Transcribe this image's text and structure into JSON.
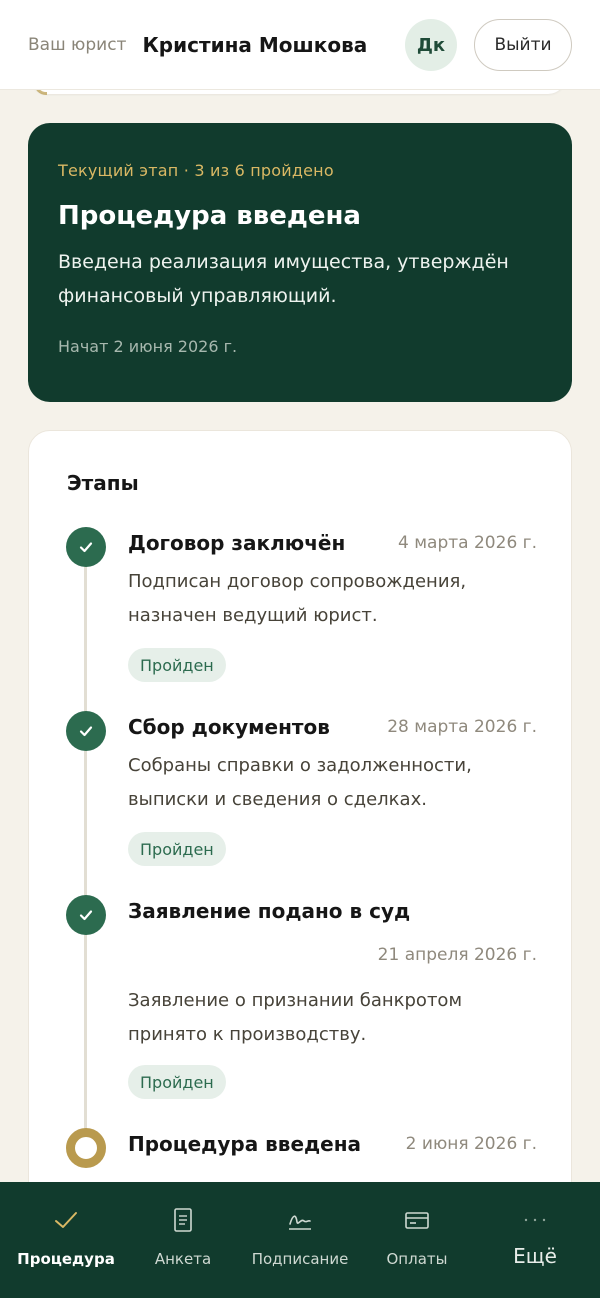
{
  "header": {
    "lawyer_caption": "Ваш юрист",
    "lawyer_name": "Кристина Мошкова",
    "avatar_initials": "Дк",
    "logout_label": "Выйти"
  },
  "current_stage": {
    "kicker": "Текущий этап · 3 из 6 пройдено",
    "title": "Процедура введена",
    "description": "Введена реализация имущества, утверждён финансовый управляющий.",
    "started": "Начат 2 июня 2026 г."
  },
  "stages": {
    "title": "Этапы",
    "items": [
      {
        "name": "Договор заключён",
        "date": "4 марта 2026 г.",
        "description": "Подписан договор сопровождения, назначен ведущий юрист.",
        "badge": "Пройден",
        "status": "done"
      },
      {
        "name": "Сбор документов",
        "date": "28 марта 2026 г.",
        "description": "Собраны справки о задолженности, выписки и сведения о сделках.",
        "badge": "Пройден",
        "status": "done"
      },
      {
        "name": "Заявление подано в суд",
        "date": "21 апреля 2026 г.",
        "description": "Заявление о признании банкротом принято к производству.",
        "badge": "Пройден",
        "status": "done"
      },
      {
        "name": "Процедура введена",
        "date": "2 июня 2026 г.",
        "status": "current"
      }
    ]
  },
  "bottom_nav": {
    "items": [
      {
        "label": "Процедура",
        "icon": "check-icon",
        "active": true
      },
      {
        "label": "Анкета",
        "icon": "document-icon",
        "active": false
      },
      {
        "label": "Подписание",
        "icon": "signature-icon",
        "active": false
      },
      {
        "label": "Оплаты",
        "icon": "card-icon",
        "active": false
      },
      {
        "label": "Ещё",
        "icon": "more-dots-icon",
        "active": false
      }
    ]
  },
  "colors": {
    "brand_dark": "#113b2d",
    "accent_gold": "#d9b864",
    "done_green": "#2c6b4f",
    "current_ring": "#b99a4e",
    "background": "#f5f2ea"
  }
}
